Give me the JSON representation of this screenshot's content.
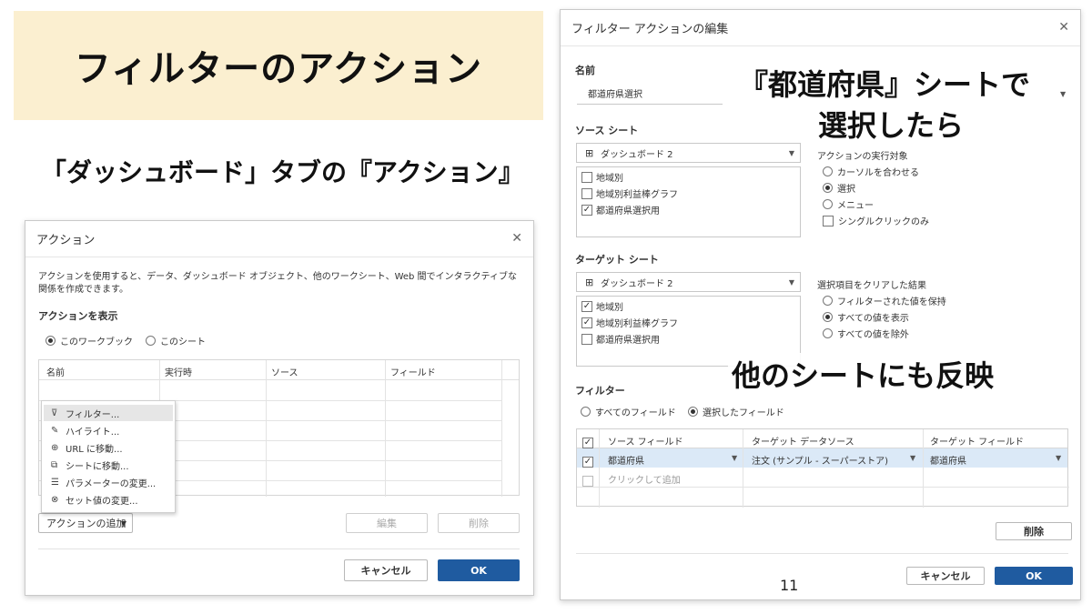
{
  "slide": {
    "title": "フィルターのアクション",
    "subtitle": "「ダッシュボード」タブの『アクション』",
    "annotation_top_line1": "『都道府県』シートで",
    "annotation_top_line2": "選択したら",
    "annotation_bottom": "他のシートにも反映",
    "page_number": "11"
  },
  "actions_dialog": {
    "title": "アクション",
    "description": "アクションを使用すると、データ、ダッシュボード オブジェクト、他のワークシート、Web 間でインタラクティブな関係を作成できます。",
    "show_actions_label": "アクションを表示",
    "radio_workbook": "このワークブック",
    "radio_sheet": "このシート",
    "columns": [
      "名前",
      "実行時",
      "ソース",
      "フィールド"
    ],
    "add_action_button": "アクションの追加",
    "edit_button": "編集",
    "delete_button": "削除",
    "cancel_button": "キャンセル",
    "ok_button": "OK"
  },
  "add_menu": {
    "items": [
      {
        "label": "フィルター...",
        "icon": "filter-icon",
        "glyph": "⊽"
      },
      {
        "label": "ハイライト...",
        "icon": "highlight-pen-icon",
        "glyph": "✎"
      },
      {
        "label": "URL に移動...",
        "icon": "globe-icon",
        "glyph": "⊕"
      },
      {
        "label": "シートに移動...",
        "icon": "go-to-sheet-icon",
        "glyph": "⧉"
      },
      {
        "label": "パラメーターの変更...",
        "icon": "parameter-sliders-icon",
        "glyph": "☰"
      },
      {
        "label": "セット値の変更...",
        "icon": "set-icon",
        "glyph": "⊗"
      }
    ]
  },
  "edit_dialog": {
    "title": "フィルター アクションの編集",
    "name_label": "名前",
    "name_value": "都道府県選択",
    "source_sheets_label": "ソース シート",
    "source_dashboard": "ダッシュボード 2",
    "source_sheets": [
      {
        "label": "地域別",
        "checked": false
      },
      {
        "label": "地域別利益棒グラフ",
        "checked": false
      },
      {
        "label": "都道府県選択用",
        "checked": true
      }
    ],
    "run_on_label": "アクションの実行対象",
    "run_on_options": [
      {
        "label": "カーソルを合わせる",
        "type": "radio",
        "selected": false
      },
      {
        "label": "選択",
        "type": "radio",
        "selected": true
      },
      {
        "label": "メニュー",
        "type": "radio",
        "selected": false
      },
      {
        "label": "シングルクリックのみ",
        "type": "checkbox",
        "selected": false
      }
    ],
    "target_sheets_label": "ターゲット シート",
    "target_dashboard": "ダッシュボード 2",
    "target_sheets": [
      {
        "label": "地域別",
        "checked": true
      },
      {
        "label": "地域別利益棒グラフ",
        "checked": true
      },
      {
        "label": "都道府県選択用",
        "checked": false
      }
    ],
    "clearing_label": "選択項目をクリアした結果",
    "clearing_options": [
      {
        "label": "フィルターされた値を保持",
        "selected": false
      },
      {
        "label": "すべての値を表示",
        "selected": true
      },
      {
        "label": "すべての値を除外",
        "selected": false
      }
    ],
    "filter_label": "フィルター",
    "filter_all_fields": "すべてのフィールド",
    "filter_selected_fields": "選択したフィールド",
    "table_columns": [
      "ソース フィールド",
      "ターゲット データソース",
      "ターゲット フィールド"
    ],
    "table_rows": [
      {
        "source_field": "都道府県",
        "target_datasource": "注文 (サンプル - スーパーストア)",
        "target_field": "都道府県",
        "checked": true
      }
    ],
    "add_row_placeholder": "クリックして追加",
    "delete_button": "削除",
    "cancel_button": "キャンセル",
    "ok_button": "OK"
  },
  "colors": {
    "banner": "#fbefd0",
    "primary_button": "#1f5ba0",
    "selected_row": "#dbe9f7"
  }
}
